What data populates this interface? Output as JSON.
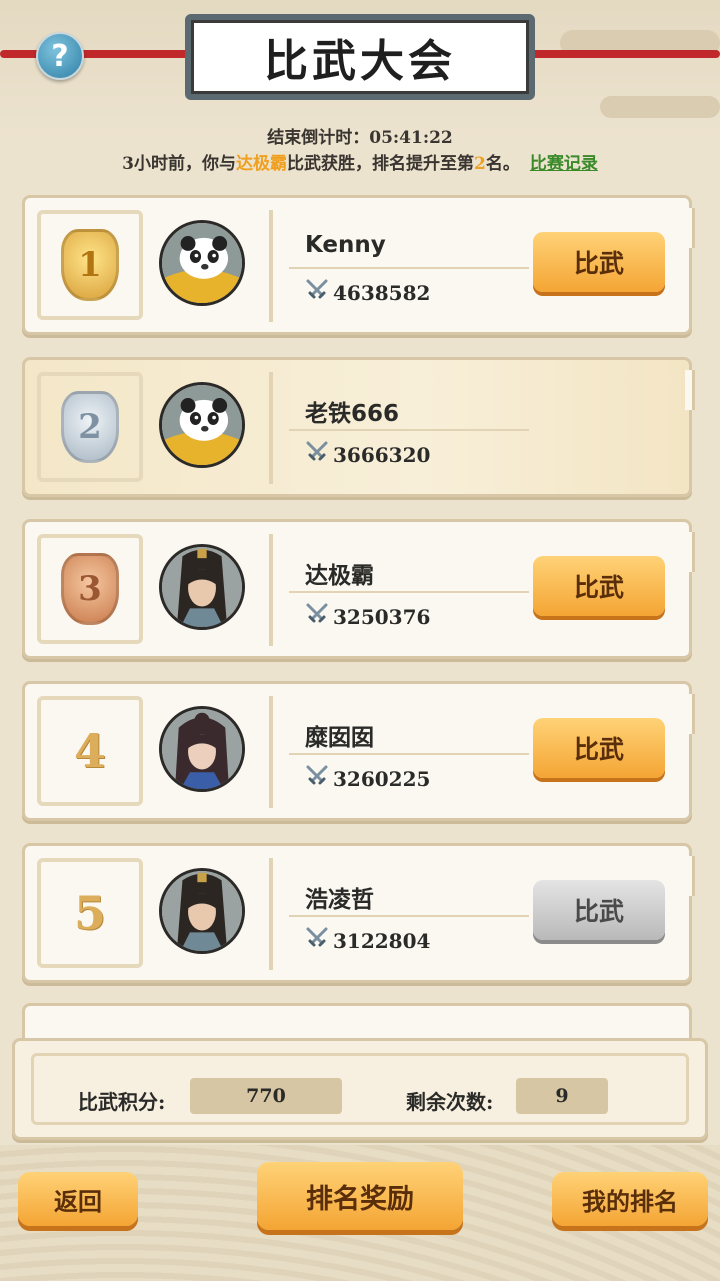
{
  "header": {
    "title": "比武大会",
    "help_label": "?",
    "countdown_label": "结束倒计时：",
    "countdown_value": "05:41:22"
  },
  "news": {
    "prefix": "3小时前，你与",
    "opponent": "达极霸",
    "middle": "比武获胜，排名提升至第",
    "rank": "2",
    "suffix": "名。",
    "record_link": "比赛记录"
  },
  "players": [
    {
      "rank": "1",
      "name": "Kenny",
      "power": "4638582",
      "button": "比武",
      "button_state": "active",
      "medal": "gold",
      "avatar": "panda"
    },
    {
      "rank": "2",
      "name": "老铁666",
      "power": "3666320",
      "button": "",
      "button_state": "self",
      "medal": "silver",
      "avatar": "panda"
    },
    {
      "rank": "3",
      "name": "达极霸",
      "power": "3250376",
      "button": "比武",
      "button_state": "active",
      "medal": "bronze",
      "avatar": "swordsman"
    },
    {
      "rank": "4",
      "name": "糜囡囡",
      "power": "3260225",
      "button": "比武",
      "button_state": "active",
      "medal": "none",
      "avatar": "lady"
    },
    {
      "rank": "5",
      "name": "浩凌哲",
      "power": "3122804",
      "button": "比武",
      "button_state": "disabled",
      "medal": "none",
      "avatar": "swordsman"
    }
  ],
  "stats": {
    "score_label": "比武积分:",
    "score_value": "770",
    "remaining_label": "剩余次数:",
    "remaining_value": "9"
  },
  "footer": {
    "back_label": "返回",
    "rewards_label": "排名奖励",
    "my_rank_label": "我的排名"
  },
  "colors": {
    "accent": "#f4a534",
    "highlight": "#f0a020",
    "link": "#3a8a2a"
  }
}
